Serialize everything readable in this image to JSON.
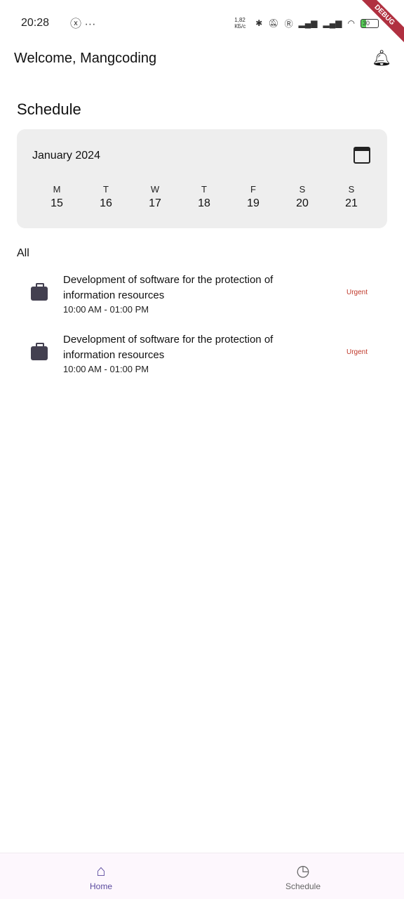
{
  "status": {
    "time": "20:28",
    "speed": "1,82 КБ/с",
    "battery": "30",
    "debug": "DEBUG"
  },
  "header": {
    "welcome": "Welcome, Mangcoding"
  },
  "schedule": {
    "title": "Schedule",
    "month": "January 2024",
    "days": [
      {
        "l": "M",
        "n": "15"
      },
      {
        "l": "T",
        "n": "16"
      },
      {
        "l": "W",
        "n": "17"
      },
      {
        "l": "T",
        "n": "18"
      },
      {
        "l": "F",
        "n": "19"
      },
      {
        "l": "S",
        "n": "20"
      },
      {
        "l": "S",
        "n": "21"
      }
    ]
  },
  "filter": "All",
  "tasks": [
    {
      "title": "Development of software for the protection of information resources",
      "time": "10:00 AM - 01:00 PM",
      "priority": "Urgent"
    },
    {
      "title": "Development of software for the protection of information resources",
      "time": "10:00 AM - 01:00 PM",
      "priority": "Urgent"
    }
  ],
  "nav": {
    "home": "Home",
    "schedule": "Schedule"
  }
}
